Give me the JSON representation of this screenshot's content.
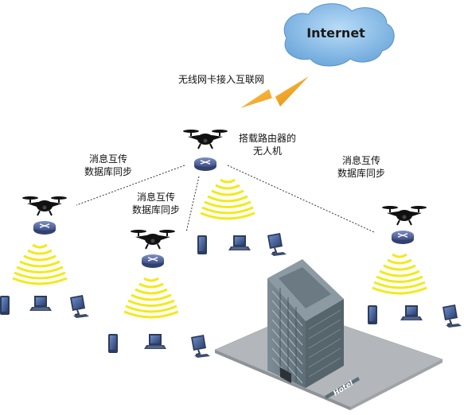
{
  "cloud": {
    "label": "Internet"
  },
  "uplink": {
    "label": "无线网卡接入互联网"
  },
  "main_drone": {
    "label_line1": "搭载路由器的",
    "label_line2": "无人机"
  },
  "sync_labels": [
    {
      "line1": "消息互传",
      "line2": "数据库同步"
    },
    {
      "line1": "消息互传",
      "line2": "数据库同步"
    },
    {
      "line1": "消息互传",
      "line2": "数据库同步"
    }
  ],
  "building": {
    "label": "Hotel"
  },
  "colors": {
    "cloud": "#8cc0ec",
    "lightning": "#f5a21a",
    "wifi": "#f2ea1a",
    "router": "#5b6fa6",
    "device": "#3a4a6a",
    "building": "#6f7f88",
    "ground": "#aeb3b7"
  },
  "icons": [
    "cloud-icon",
    "lightning-icon",
    "drone-icon",
    "router-icon",
    "wifi-signal-icon",
    "tablet-icon",
    "laptop-icon",
    "desktop-icon",
    "building-icon"
  ]
}
